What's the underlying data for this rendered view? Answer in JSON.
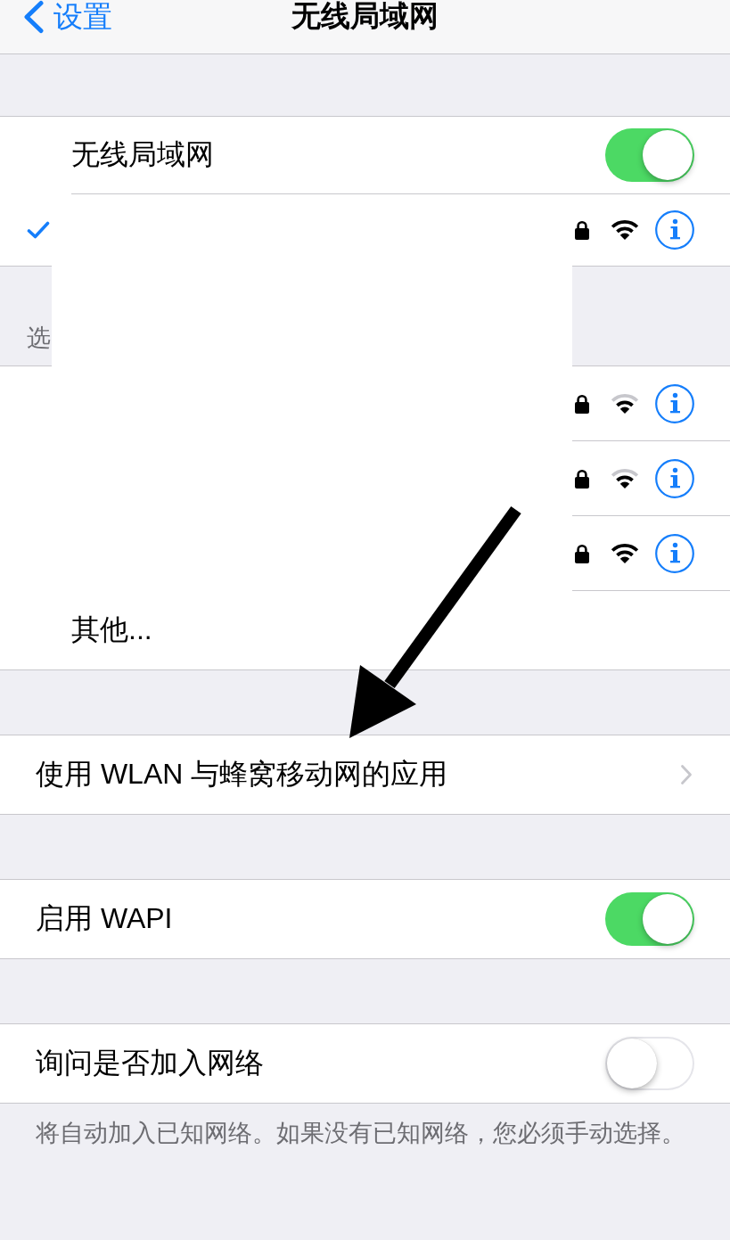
{
  "nav": {
    "back_label": "设置",
    "title": "无线局域网"
  },
  "wlan": {
    "label": "无线局域网",
    "on": true
  },
  "connected_network": {
    "selected": true,
    "secured": true,
    "strong_signal": true
  },
  "networks_header": "选",
  "networks": [
    {
      "secured": true,
      "strong_signal": false
    },
    {
      "secured": true,
      "strong_signal": false
    },
    {
      "secured": true,
      "strong_signal": true
    }
  ],
  "other_label": "其他...",
  "apps_row": {
    "label": "使用 WLAN 与蜂窝移动网的应用"
  },
  "wapi": {
    "label": "启用 WAPI",
    "on": true
  },
  "ask_to_join": {
    "label": "询问是否加入网络",
    "on": false
  },
  "footer": "将自动加入已知网络。如果没有已知网络，您必须手动选择。"
}
